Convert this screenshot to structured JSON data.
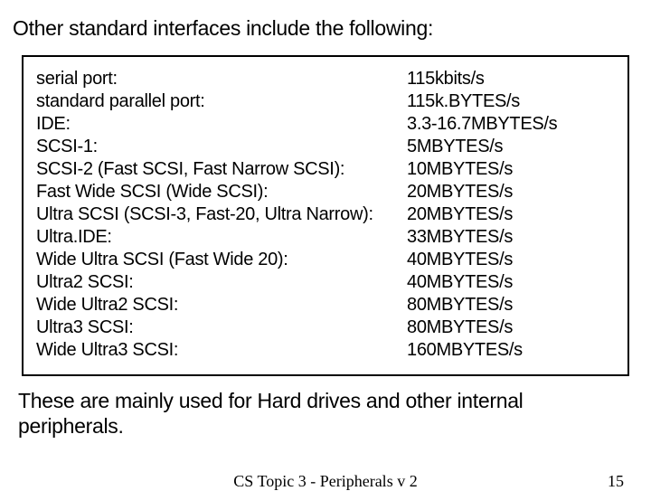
{
  "heading": "Other standard interfaces include the following:",
  "table": {
    "rows": [
      {
        "name": "serial port:",
        "rate": "115kbits/s"
      },
      {
        "name": "standard parallel port:",
        "rate": "115k.BYTES/s"
      },
      {
        "name": "IDE:",
        "rate": "3.3-16.7MBYTES/s"
      },
      {
        "name": "SCSI-1:",
        "rate": "5MBYTES/s"
      },
      {
        "name": "SCSI-2 (Fast SCSI, Fast Narrow SCSI):",
        "rate": "10MBYTES/s"
      },
      {
        "name": "Fast Wide SCSI (Wide SCSI):",
        "rate": "20MBYTES/s"
      },
      {
        "name": "Ultra SCSI (SCSI-3, Fast-20, Ultra Narrow):",
        "rate": "20MBYTES/s"
      },
      {
        "name": "Ultra.IDE:",
        "rate": "33MBYTES/s"
      },
      {
        "name": "Wide Ultra SCSI (Fast Wide 20):",
        "rate": "40MBYTES/s"
      },
      {
        "name": "Ultra2 SCSI:",
        "rate": "40MBYTES/s"
      },
      {
        "name": "Wide Ultra2 SCSI:",
        "rate": "80MBYTES/s"
      },
      {
        "name": "Ultra3 SCSI:",
        "rate": "80MBYTES/s"
      },
      {
        "name": "Wide Ultra3 SCSI:",
        "rate": "160MBYTES/s"
      }
    ]
  },
  "note": "These are mainly used for Hard drives and other internal peripherals.",
  "footer": {
    "center": "CS Topic 3 - Peripherals v 2",
    "page": "15"
  }
}
